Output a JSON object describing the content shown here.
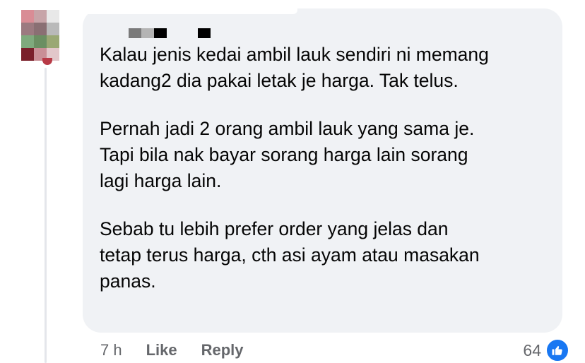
{
  "comment": {
    "paragraphs": [
      "Kalau jenis kedai ambil lauk sendiri ni memang\nkadang2 dia pakai letak je harga. Tak telus.",
      "Pernah jadi 2 orang ambil lauk yang sama je.\nTapi bila nak bayar sorang harga lain sorang\nlagi harga lain.",
      "Sebab tu lebih prefer order yang jelas dan\ntetap terus harga, cth asi ayam atau masakan\npanas."
    ],
    "timestamp": "7 h",
    "like_label": "Like",
    "reply_label": "Reply",
    "reaction_count": "64",
    "reaction_icon": "thumbs-up-icon"
  },
  "colors": {
    "bubble": "#f0f2f5",
    "text": "#050505",
    "meta": "#65676b",
    "like_blue": "#1877f2"
  }
}
